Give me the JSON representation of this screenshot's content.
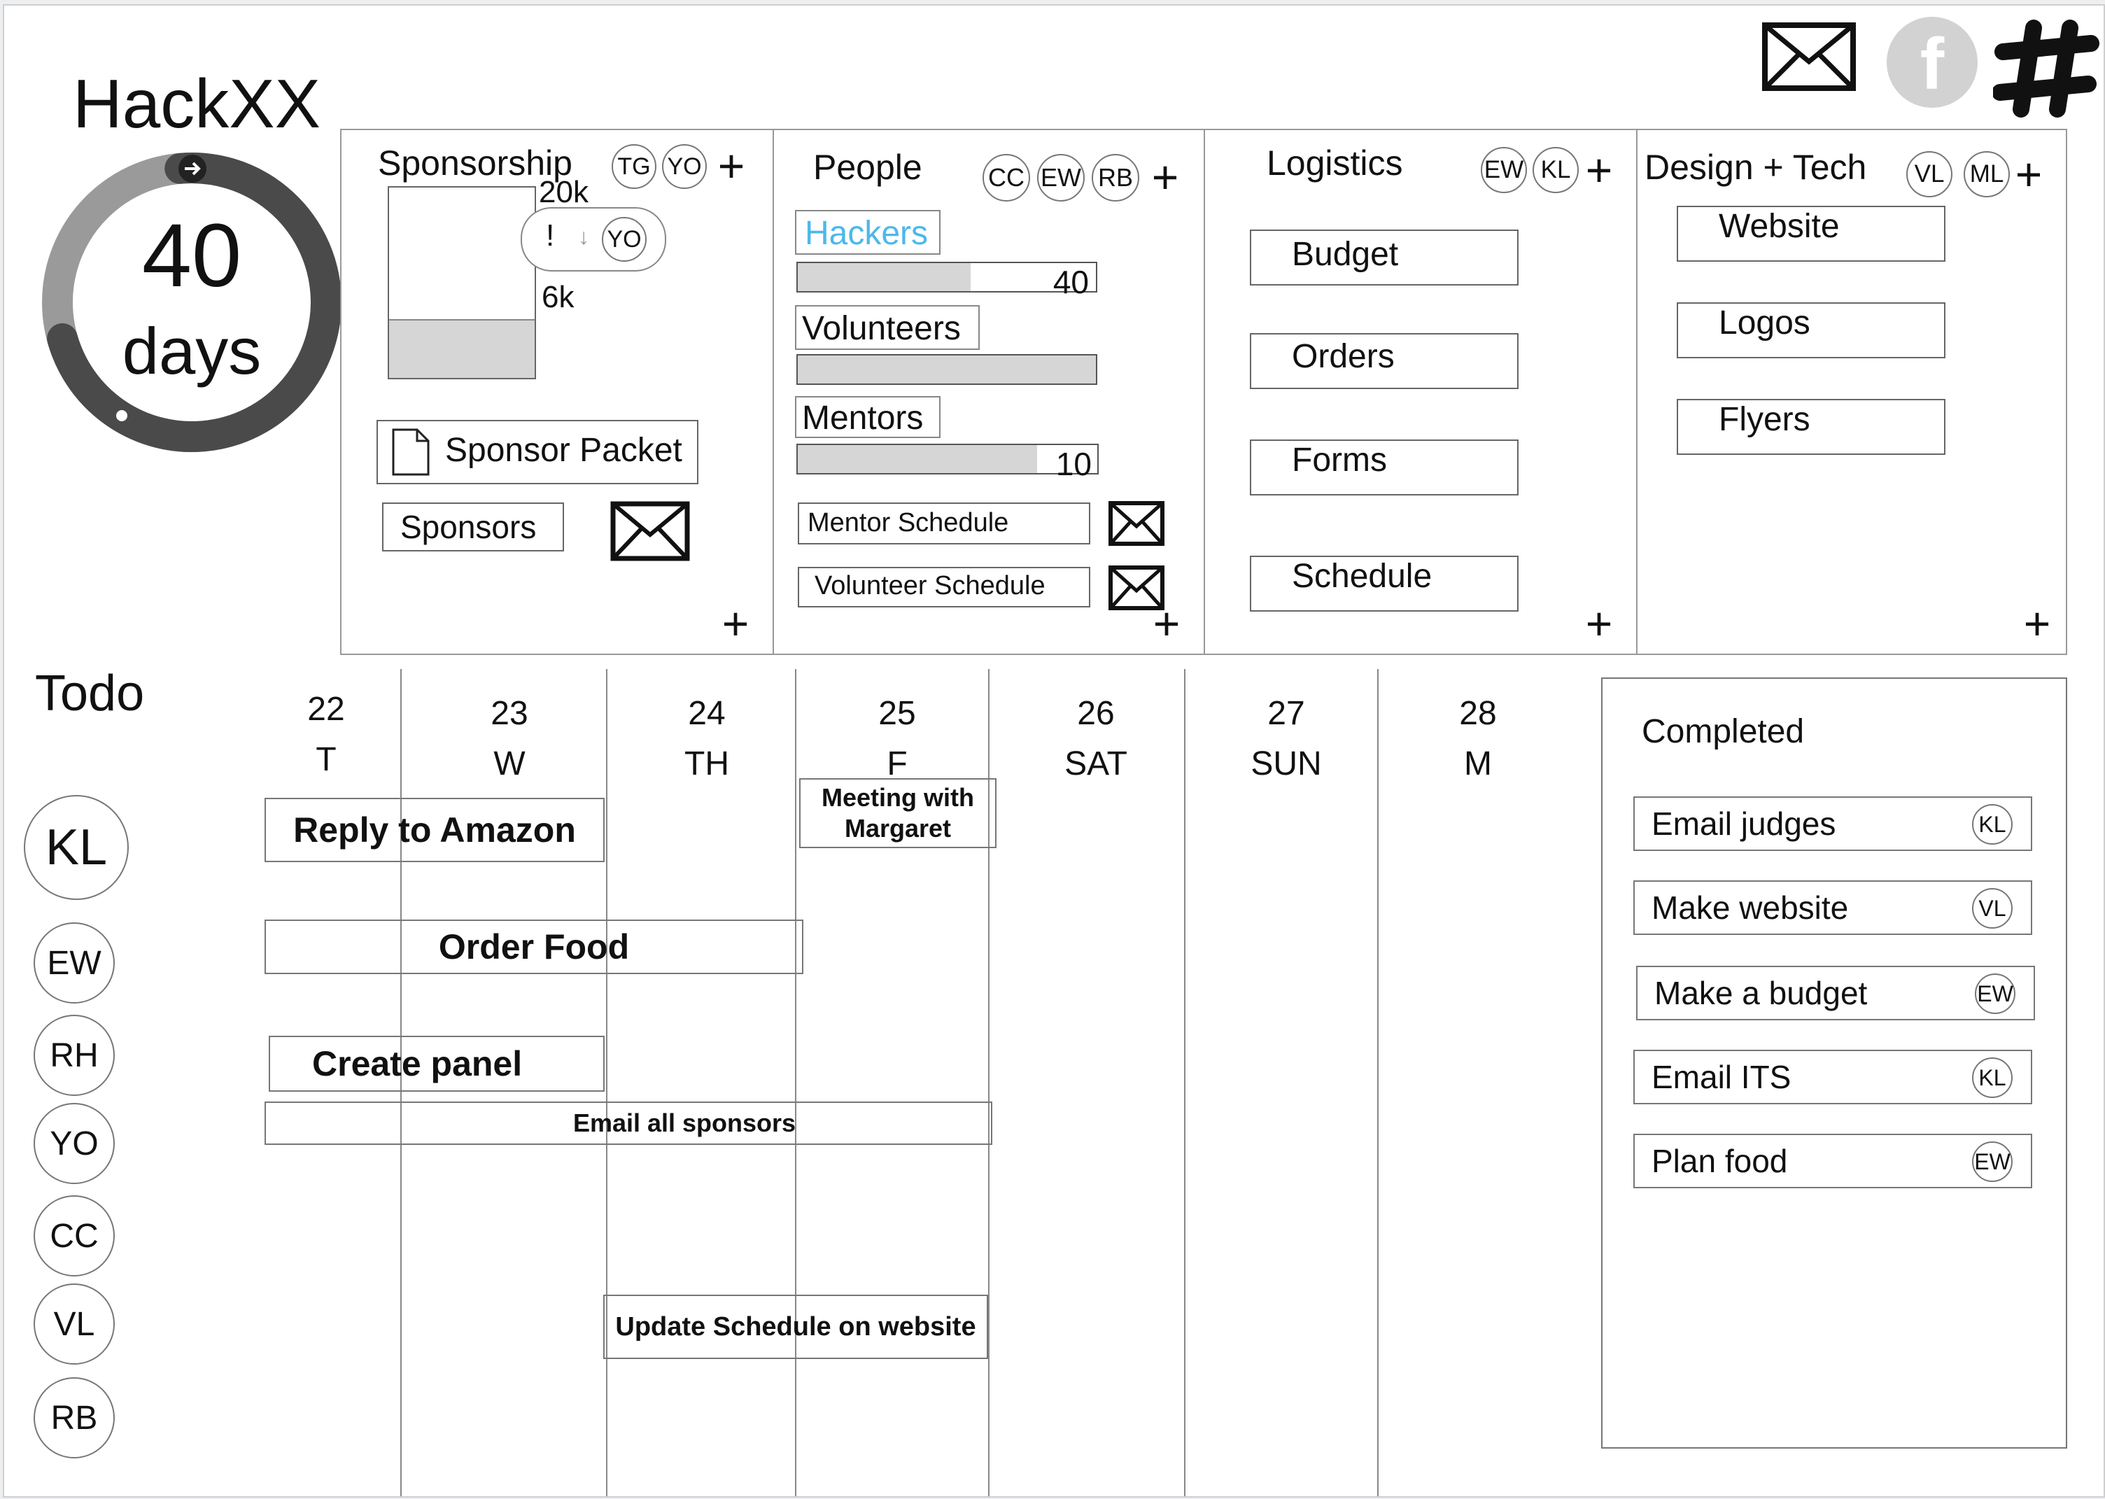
{
  "app": {
    "title": "HackXX"
  },
  "countdown": {
    "value": "40",
    "unit": "days",
    "progress": 0.72
  },
  "social": {
    "icons": [
      "mail-icon",
      "facebook-icon",
      "slack-icon"
    ]
  },
  "sponsorship": {
    "title": "Sponsorship",
    "members": [
      "TG",
      "YO"
    ],
    "goal_label": "20k",
    "current_label": "6k",
    "progress": 0.3,
    "alert": {
      "mark": "!",
      "member": "YO"
    },
    "packet_label": "Sponsor Packet",
    "sponsors_label": "Sponsors"
  },
  "people": {
    "title": "People",
    "members": [
      "CC",
      "EW",
      "RB"
    ],
    "groups": [
      {
        "label": "Hackers",
        "count": "40",
        "progress": 0.58
      },
      {
        "label": "Volunteers",
        "count": "",
        "progress": 1.0
      },
      {
        "label": "Mentors",
        "count": "10",
        "progress": 0.8
      }
    ],
    "schedules": [
      "Mentor Schedule",
      "Volunteer Schedule"
    ]
  },
  "logistics": {
    "title": "Logistics",
    "members": [
      "EW",
      "KL"
    ],
    "items": [
      "Budget",
      "Orders",
      "Forms",
      "Schedule"
    ]
  },
  "design": {
    "title": "Design + Tech",
    "members": [
      "VL",
      "ML"
    ],
    "items": [
      "Website",
      "Logos",
      "Flyers"
    ]
  },
  "todo": {
    "title": "Todo",
    "members": [
      "KL",
      "EW",
      "RH",
      "YO",
      "CC",
      "VL",
      "RB"
    ],
    "days": [
      {
        "date": "22",
        "day": "T"
      },
      {
        "date": "23",
        "day": "W"
      },
      {
        "date": "24",
        "day": "TH"
      },
      {
        "date": "25",
        "day": "F"
      },
      {
        "date": "26",
        "day": "SAT"
      },
      {
        "date": "27",
        "day": "SUN"
      },
      {
        "date": "28",
        "day": "M"
      }
    ],
    "tasks": [
      {
        "label": "Reply to Amazon"
      },
      {
        "label": "Order Food"
      },
      {
        "label": "Create panel"
      },
      {
        "label": "Email all sponsors"
      },
      {
        "label": "Meeting with Margaret"
      },
      {
        "label": "Update Schedule on website"
      }
    ]
  },
  "completed": {
    "title": "Completed",
    "items": [
      {
        "label": "Email judges",
        "member": "KL"
      },
      {
        "label": "Make website",
        "member": "VL"
      },
      {
        "label": "Make a budget",
        "member": "EW"
      },
      {
        "label": "Email ITS",
        "member": "KL"
      },
      {
        "label": "Plan food",
        "member": "EW"
      }
    ]
  },
  "colors": {
    "accent": "#4db8ea",
    "bar_fill": "#d6d6d6",
    "border": "#666666",
    "ring_dark": "#4a4a4a",
    "ring_light": "#9a9a9a"
  }
}
